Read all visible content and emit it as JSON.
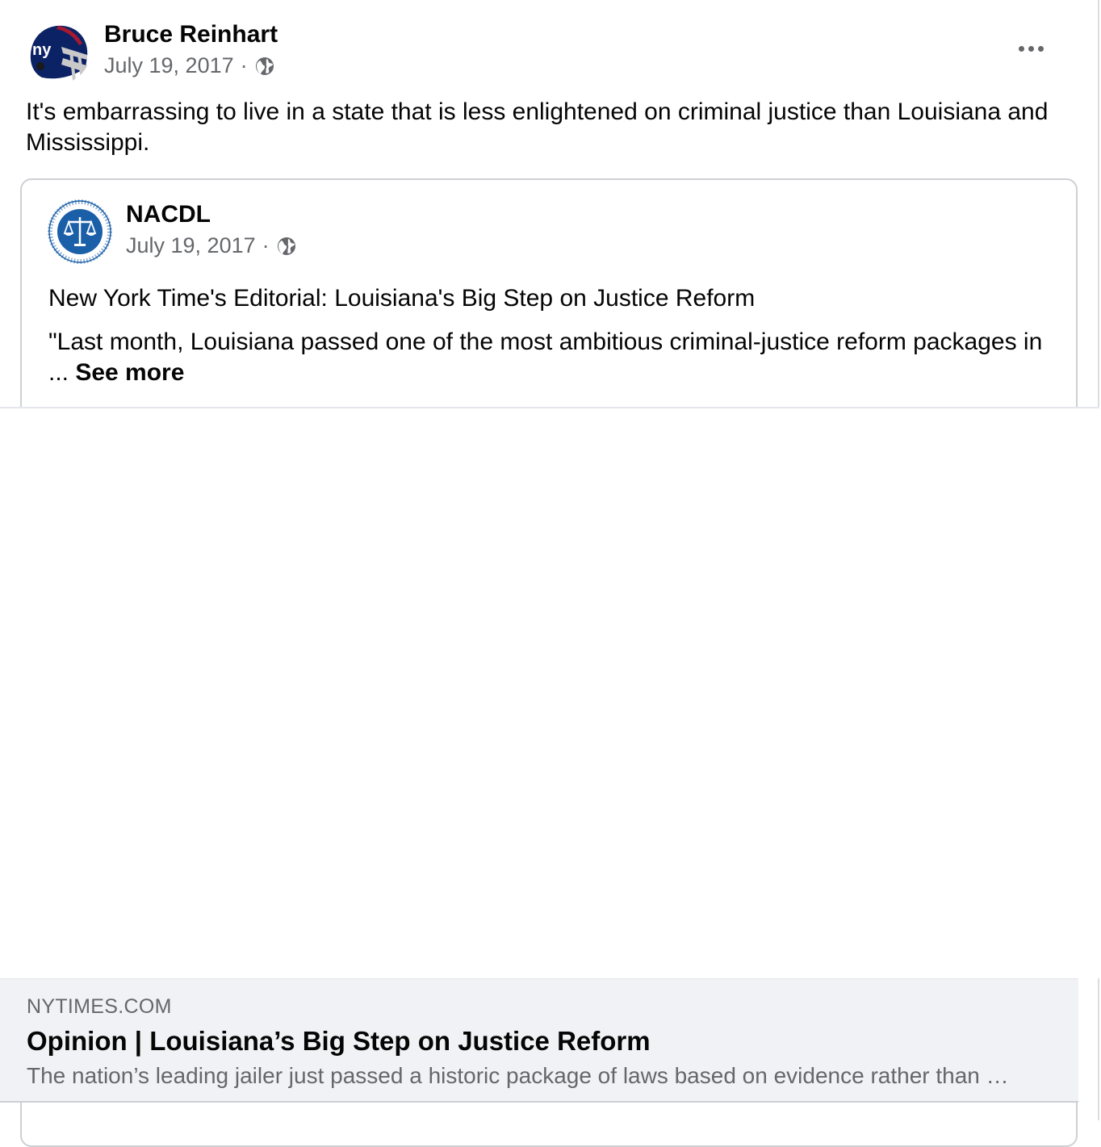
{
  "post": {
    "author": "Bruce Reinhart",
    "date": "July 19, 2017",
    "separator": "·",
    "avatar_icon": "giants-helmet-icon",
    "text": "It's embarrassing to live in a state that is less enlightened on criminal justice than Louisiana and Mississippi.",
    "more_icon": "more-options-icon"
  },
  "shared": {
    "author": "NACDL",
    "date": "July 19, 2017",
    "separator": "·",
    "avatar_icon": "nacdl-scales-logo-icon",
    "headline": "New York Time's Editorial: Louisiana's Big Step on Justice Reform",
    "body": "\"Last month, Louisiana passed one of the most ambitious criminal-justice reform packages in ... ",
    "see_more": "See more"
  },
  "link_card": {
    "domain": "NYTIMES.COM",
    "title": "Opinion | Louisiana’s Big Step on Justice Reform",
    "description": "The nation’s leading jailer just passed a historic package of laws based on evidence rather than …"
  },
  "colors": {
    "giants_blue": "#0b2265",
    "giants_red": "#a71930",
    "nacdl_blue": "#1b5fa8",
    "secondary_text": "#65676b"
  }
}
